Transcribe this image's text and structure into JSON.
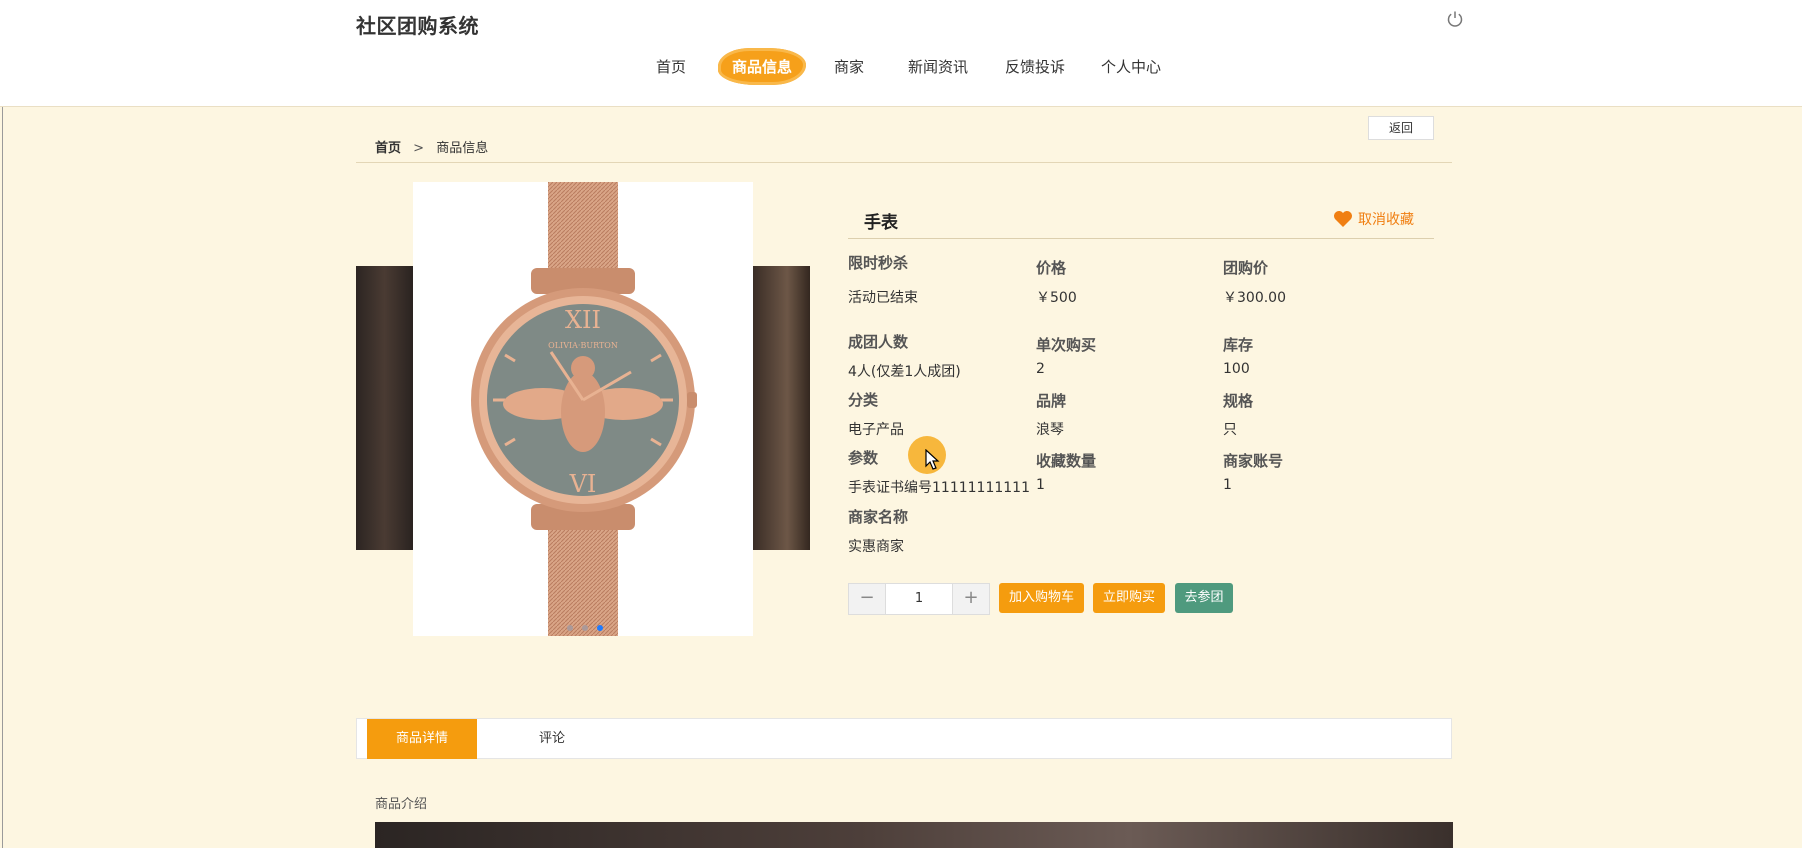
{
  "header": {
    "site_title": "社区团购系统",
    "nav": [
      "首页",
      "商品信息",
      "商家",
      "新闻资讯",
      "反馈投诉",
      "个人中心"
    ],
    "active_nav": "商品信息",
    "power_icon": "power-icon"
  },
  "breadcrumb": {
    "home": "首页",
    "separator": ">",
    "current": "商品信息"
  },
  "back_label": "返回",
  "gallery": {
    "slides_count": 3,
    "active_slide": 3
  },
  "product": {
    "name": "手表",
    "fav_label": "取消收藏",
    "fields": {
      "flash_label": "限时秒杀",
      "flash_value": "活动已结束",
      "price_label": "价格",
      "price_value": "￥500",
      "group_price_label": "团购价",
      "group_price_value": "￥300.00",
      "group_size_label": "成团人数",
      "group_size_value": "4人(仅差1人成团)",
      "single_buy_label": "单次购买",
      "single_buy_value": "2",
      "stock_label": "库存",
      "stock_value": "100",
      "category_label": "分类",
      "category_value": "电子产品",
      "brand_label": "品牌",
      "brand_value": "浪琴",
      "spec_label": "规格",
      "spec_value": "只",
      "param_label": "参数",
      "param_value": "手表证书编号11111111111",
      "fav_count_label": "收藏数量",
      "fav_count_value": "1",
      "merchant_account_label": "商家账号",
      "merchant_account_value": "1",
      "merchant_name_label": "商家名称",
      "merchant_name_value": "实惠商家"
    },
    "quantity": "1",
    "buttons": {
      "add_cart": "加入购物车",
      "buy_now": "立即购买",
      "join_group": "去参团"
    }
  },
  "tabs": [
    "商品详情",
    "评论"
  ],
  "active_tab": "商品详情",
  "intro_title": "商品介绍",
  "colors": {
    "accent": "#f59c0e",
    "green": "#4f9a7e",
    "page_bg": "#fdf6e1",
    "fav": "#f07f12"
  }
}
